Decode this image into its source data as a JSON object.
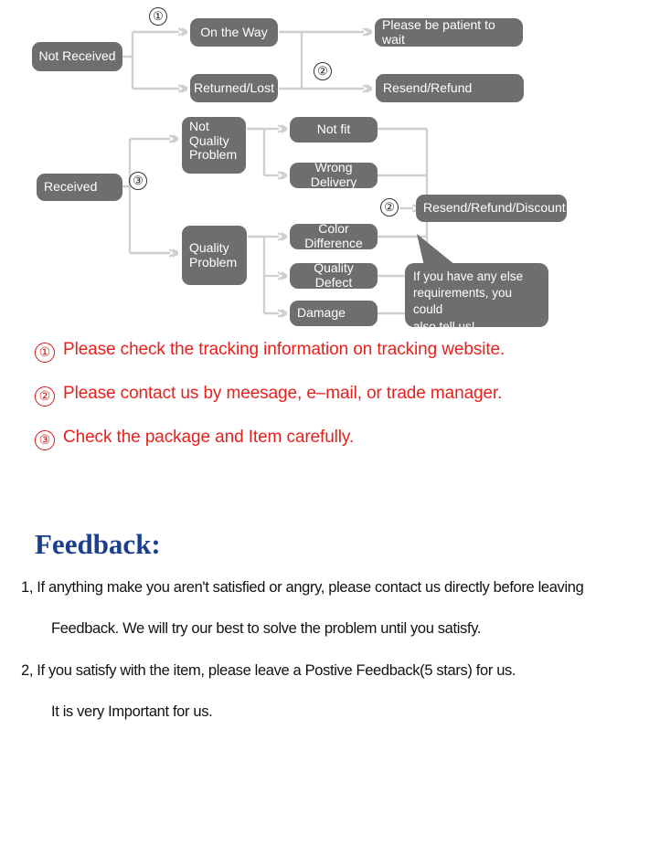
{
  "flowchart": {
    "nodes": [
      {
        "id": "not-received",
        "label": "Not Received"
      },
      {
        "id": "on-the-way",
        "label": "On the Way"
      },
      {
        "id": "returned-lost",
        "label": "Returned/Lost"
      },
      {
        "id": "please-be-patient",
        "label": "Please be patient to wait"
      },
      {
        "id": "resend-refund",
        "label": "Resend/Refund"
      },
      {
        "id": "received",
        "label": "Received"
      },
      {
        "id": "not-quality-problem",
        "label": "Not\nQuality\nProblem"
      },
      {
        "id": "quality-problem",
        "label": "Quality\nProblem"
      },
      {
        "id": "not-fit",
        "label": "Not fit"
      },
      {
        "id": "wrong-delivery",
        "label": "Wrong Delivery"
      },
      {
        "id": "color-difference",
        "label": "Color Difference"
      },
      {
        "id": "quality-defect",
        "label": "Quality Defect"
      },
      {
        "id": "damage",
        "label": "Damage"
      },
      {
        "id": "resend-refund-discount",
        "label": "Resend/Refund/Discount"
      }
    ],
    "markers": [
      {
        "id": "marker-1-top",
        "label": "①"
      },
      {
        "id": "marker-2-top",
        "label": "②"
      },
      {
        "id": "marker-3-left",
        "label": "③"
      },
      {
        "id": "marker-2-right",
        "label": "②"
      }
    ],
    "bubble": {
      "text": "If you have any else\nrequirements, you could\nalso tell us!"
    },
    "colors": {
      "node_fill": "#6e6e6e",
      "node_text": "#ffffff",
      "connector": "#cfcfcf"
    }
  },
  "notes": {
    "items": [
      {
        "num": "①",
        "text": "Please check the tracking information on tracking website."
      },
      {
        "num": "②",
        "text": "Please contact us by meesage, e–mail, or trade manager."
      },
      {
        "num": "③",
        "text": "Check the package and Item carefully."
      }
    ],
    "color": "#e8201c"
  },
  "feedback": {
    "title": "Feedback:",
    "title_color": "#1a3f8f",
    "lines": [
      "1, If anything make you aren't satisfied or angry, please contact us directly before leaving",
      "Feedback. We will try our best to solve the problem until you satisfy.",
      "2, If you satisfy with the item, please leave a Postive Feedback(5 stars) for us.",
      "It is very Important for us."
    ]
  }
}
